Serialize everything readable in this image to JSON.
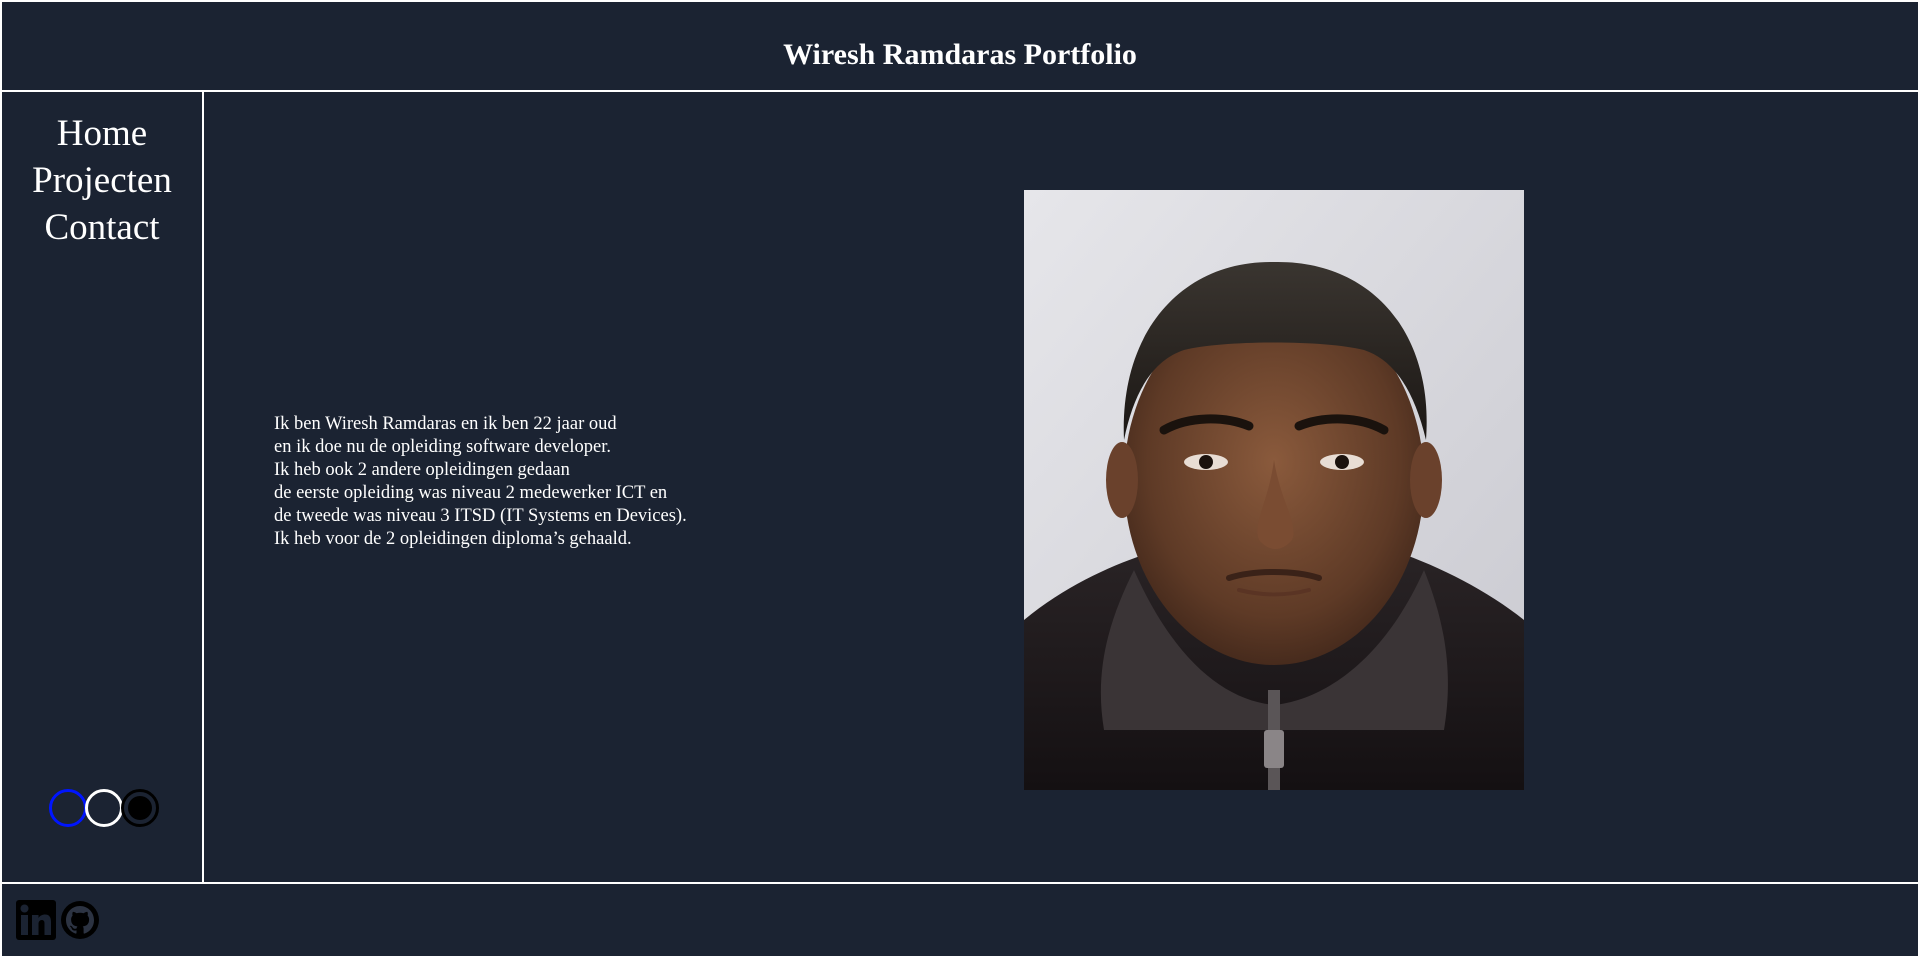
{
  "header": {
    "title": "Wiresh Ramdaras Portfolio"
  },
  "sidebar": {
    "nav": [
      {
        "label": "Home"
      },
      {
        "label": "Projecten"
      },
      {
        "label": "Contact"
      }
    ],
    "theme_options": [
      {
        "name": "blue",
        "color": "#0015ff"
      },
      {
        "name": "white",
        "color": "#ffffff"
      },
      {
        "name": "black",
        "color": "#000000"
      }
    ]
  },
  "main": {
    "bio_lines": [
      "Ik ben Wiresh Ramdaras en ik ben 22 jaar oud",
      "en ik doe nu de opleiding software developer.",
      "Ik heb ook 2 andere opleidingen gedaan",
      "de eerste opleiding was niveau 2 medewerker ICT en",
      "de tweede was niveau 3 ITSD (IT Systems en Devices).",
      "Ik heb voor de 2 opleidingen diploma’s gehaald."
    ]
  },
  "footer": {
    "social": [
      {
        "icon": "linkedin-icon"
      },
      {
        "icon": "github-icon"
      }
    ]
  },
  "colors": {
    "background": "#1b2332",
    "border": "#ffffff",
    "text": "#ffffff"
  }
}
